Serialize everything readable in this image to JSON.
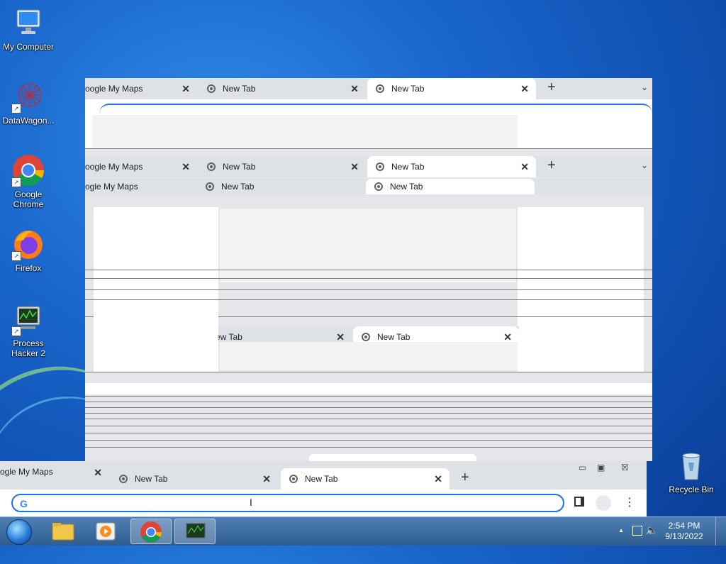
{
  "desktop": {
    "icons": [
      {
        "label": "My Computer"
      },
      {
        "label": "DataWagon..."
      },
      {
        "label": "Google Chrome"
      },
      {
        "label": "Firefox"
      },
      {
        "label": "Process Hacker 2"
      },
      {
        "label": "Recycle Bin"
      }
    ]
  },
  "browser": {
    "tabs": [
      {
        "label": "oogle My Maps"
      },
      {
        "label": "New Tab"
      },
      {
        "label": "New Tab"
      }
    ],
    "front_tabs": [
      {
        "label": "ogle My Maps"
      },
      {
        "label": "New Tab"
      },
      {
        "label": "New Tab"
      }
    ],
    "partial_tabs": {
      "maps": "ogle My Maps",
      "newtab": "New Tab",
      "lower_left": "ew Tab",
      "lower_right": "New Tab"
    },
    "close_glyph": "✕",
    "new_tab_glyph": "+",
    "dropdown_glyph": "⌄",
    "omnibox": {
      "value": "",
      "google_letter": "G"
    }
  },
  "taskbar": {
    "clock_time": "2:54 PM",
    "clock_date": "9/13/2022",
    "tray_arrow": "▲"
  },
  "colors": {
    "accent": "#1a73e8",
    "tab_strip": "#dee1e6",
    "taskbar": "#2f5d91"
  }
}
